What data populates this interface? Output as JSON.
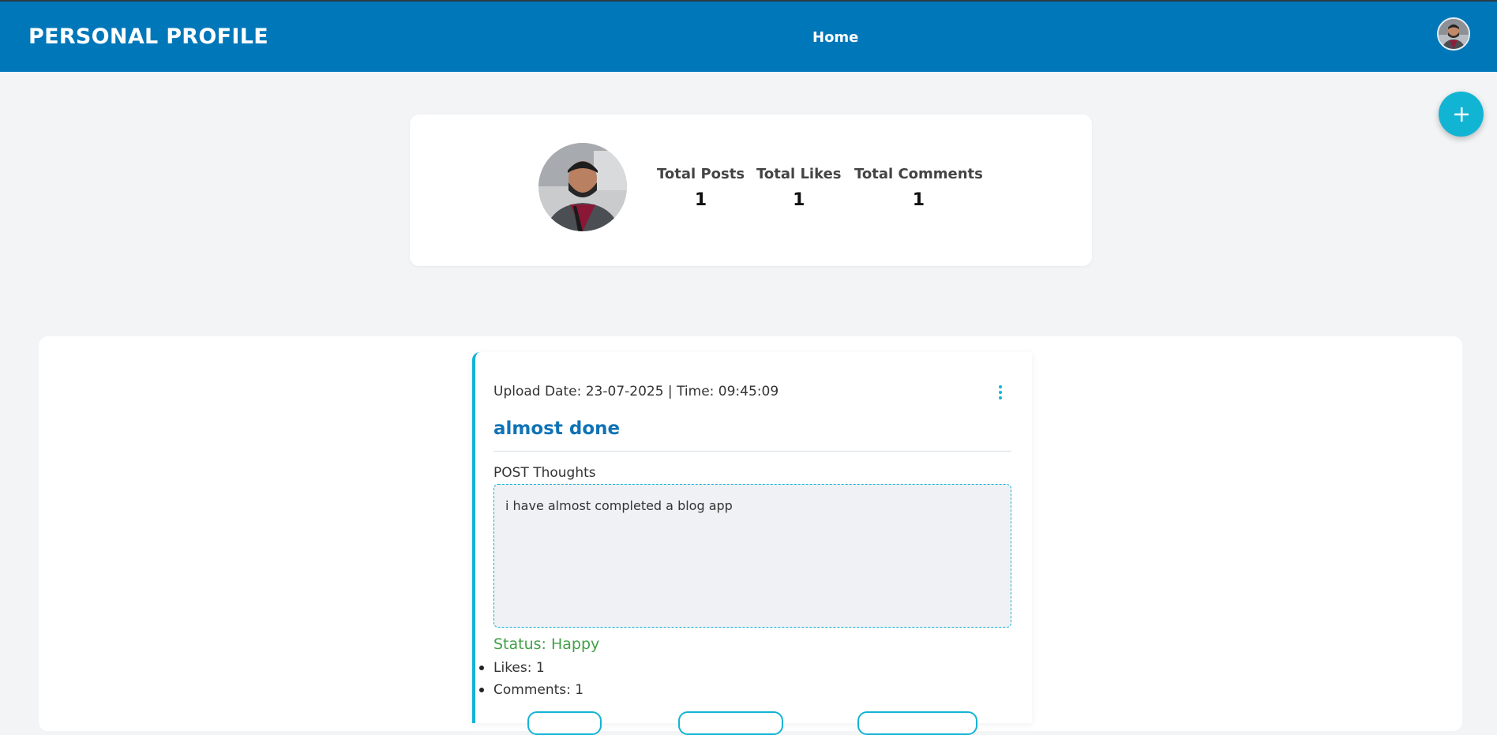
{
  "header": {
    "brand": "PERSONAL PROFILE",
    "nav_home": "Home",
    "avatar_icon": "user-avatar"
  },
  "fab": {
    "icon": "plus-icon",
    "symbol": "+"
  },
  "profile": {
    "stats": [
      {
        "label": "Total Posts",
        "value": "1"
      },
      {
        "label": "Total Likes",
        "value": "1"
      },
      {
        "label": "Total Comments",
        "value": "1"
      }
    ]
  },
  "post": {
    "upload_meta": "Upload Date: 23-07-2025 | Time: 09:45:09",
    "title": "almost done",
    "thoughts_label": "POST Thoughts",
    "thoughts_text": "i have almost completed a blog app",
    "status": "Status: Happy",
    "likes": "Likes: 1",
    "comments": "Comments: 1",
    "menu_icon": "kebab-menu-icon"
  },
  "colors": {
    "header_bg": "#0077b9",
    "accent": "#12b4d4",
    "title": "#0f73b5",
    "status": "#43a047"
  }
}
